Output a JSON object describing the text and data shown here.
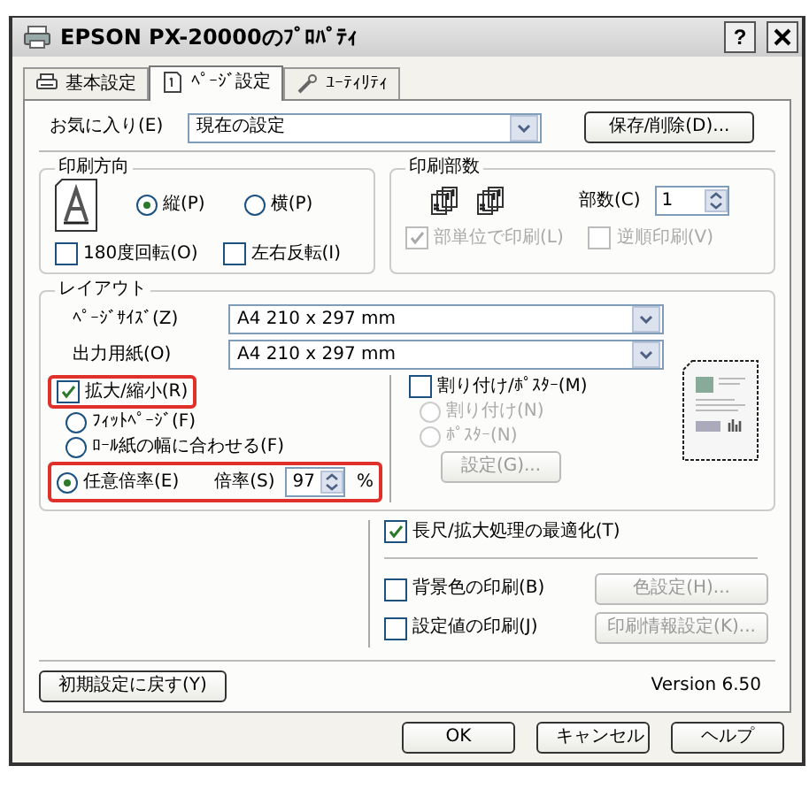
{
  "window": {
    "title": "EPSON PX-20000のﾌﾟﾛﾊﾟﾃｨ",
    "help": "?"
  },
  "tabs": [
    {
      "label": "基本設定",
      "selected": false
    },
    {
      "label": "ﾍﾟｰｼﾞ設定",
      "selected": true
    },
    {
      "label": "ﾕｰﾃｨﾘﾃｨ",
      "selected": false
    }
  ],
  "favorites": {
    "label": "お気に入り(E)",
    "value": "現在の設定",
    "button": "保存/削除(D)..."
  },
  "orientation": {
    "title": "印刷方向",
    "options": [
      {
        "label": "縦(P)",
        "selected": true
      },
      {
        "label": "横(P)",
        "selected": false
      }
    ],
    "checks": [
      {
        "label": "180度回転(O)",
        "checked": false
      },
      {
        "label": "左右反転(I)",
        "checked": false
      }
    ]
  },
  "copies": {
    "title": "印刷部数",
    "label": "部数(C)",
    "value": "1",
    "checks": [
      {
        "label": "部単位で印刷(L)",
        "checked": true,
        "disabled": true
      },
      {
        "label": "逆順印刷(V)",
        "checked": false,
        "disabled": true
      }
    ]
  },
  "layout": {
    "title": "レイアウト",
    "fields": [
      {
        "label": "ﾍﾟｰｼﾞｻｲｽﾞ(Z)",
        "value": "A4 210 x 297 mm"
      },
      {
        "label": "出力用紙(O)",
        "value": "A4 210 x 297 mm"
      }
    ],
    "scale": {
      "label": "拡大/縮小(R)",
      "checked": true,
      "highlighted": true
    },
    "scale_options": [
      {
        "kind": "plain",
        "label": "ﾌｨｯﾄﾍﾟｰｼﾞ(F)",
        "selected": false
      },
      {
        "kind": "plain",
        "label": "ﾛｰﾙ紙の幅に合わせる(F)",
        "selected": false
      },
      {
        "kind": "ratio",
        "label": "任意倍率(E)",
        "selected": true,
        "highlighted": true,
        "ratio_label": "倍率(S)",
        "value": "97",
        "unit": "%"
      }
    ],
    "multi": {
      "label": "割り付け/ﾎﾟｽﾀｰ(M)",
      "checked": false
    },
    "multi_options": [
      {
        "label": "割り付け(N)",
        "selected": false,
        "disabled": true
      },
      {
        "label": "ﾎﾟｽﾀｰ(N)",
        "selected": false,
        "disabled": true
      }
    ],
    "multi_button": {
      "label": "設定(G)...",
      "disabled": true
    }
  },
  "optimize": {
    "label": "長尺/拡大処理の最適化(T)",
    "checked": true
  },
  "extras": [
    {
      "label": "背景色の印刷(B)",
      "checked": false,
      "button": {
        "label": "色設定(H)...",
        "disabled": true
      }
    },
    {
      "label": "設定値の印刷(J)",
      "checked": false,
      "button": {
        "label": "印刷情報設定(K)...",
        "disabled": true
      }
    }
  ],
  "reset_button": "初期設定に戻す(Y)",
  "version": "Version 6.50",
  "buttons": [
    "OK",
    "キャンセル",
    "ヘルプ"
  ]
}
